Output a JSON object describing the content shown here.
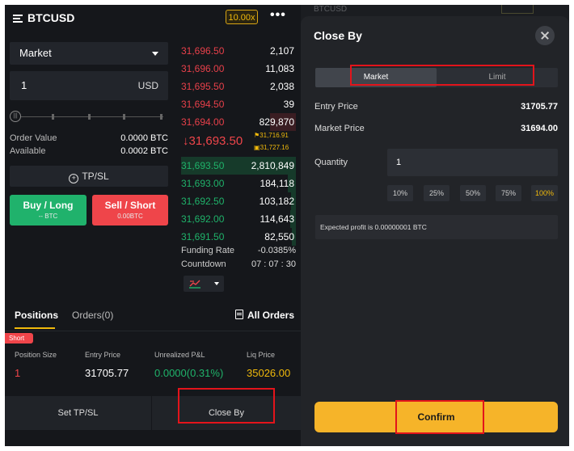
{
  "left": {
    "header": {
      "symbol": "BTCUSD",
      "leverage": "10.00x",
      "more_label": "•••"
    },
    "order_type": "Market",
    "quantity": {
      "value": "1",
      "unit": "USD"
    },
    "order_value": {
      "label": "Order Value",
      "value": "0.0000 BTC"
    },
    "available": {
      "label": "Available",
      "value": "0.0002 BTC"
    },
    "tpsl_label": "TP/SL",
    "buy": {
      "label": "Buy / Long",
      "sub": "-- BTC"
    },
    "sell": {
      "label": "Sell / Short",
      "sub": "0.00BTC"
    },
    "asks": [
      {
        "price": "31,696.50",
        "qty": "2,107"
      },
      {
        "price": "31,696.00",
        "qty": "11,083"
      },
      {
        "price": "31,695.50",
        "qty": "2,038"
      },
      {
        "price": "31,694.50",
        "qty": "39"
      },
      {
        "price": "31,694.00",
        "qty": "829,870"
      }
    ],
    "last_price": "↓31,693.50",
    "mark_price": "31,716.91",
    "index_price": "31,727.16",
    "bids": [
      {
        "price": "31,693.50",
        "qty": "2,810,849"
      },
      {
        "price": "31,693.00",
        "qty": "184,118"
      },
      {
        "price": "31,692.50",
        "qty": "103,182"
      },
      {
        "price": "31,692.00",
        "qty": "114,643"
      },
      {
        "price": "31,691.50",
        "qty": "82,550"
      }
    ],
    "funding_rate": {
      "label": "Funding Rate",
      "value": "-0.0385%"
    },
    "countdown": {
      "label": "Countdown",
      "value": "07 : 07 : 30"
    },
    "tabs": {
      "positions": "Positions",
      "orders": "Orders(0)",
      "all_orders": "All Orders"
    },
    "position": {
      "side_tag": "Short",
      "headers": [
        "Position Size",
        "Entry Price",
        "Unrealized P&L",
        "Liq Price"
      ],
      "size": "1",
      "entry_price": "31705.77",
      "pnl": "0.0000(0.31%)",
      "liq_price": "35026.00"
    },
    "bottom": {
      "set_tpsl": "Set TP/SL",
      "close_by": "Close By"
    }
  },
  "right": {
    "ghost_title": "BTCUSD",
    "title": "Close By",
    "segments": {
      "market": "Market",
      "limit": "Limit"
    },
    "entry_price": {
      "label": "Entry Price",
      "value": "31705.77"
    },
    "market_price": {
      "label": "Market Price",
      "value": "31694.00"
    },
    "quantity": {
      "label": "Quantity",
      "value": "1"
    },
    "percentages": [
      "10%",
      "25%",
      "50%",
      "75%",
      "100%"
    ],
    "selected_percentage": "100%",
    "expected_profit": "Expected profit is 0.00000001 BTC",
    "confirm": "Confirm"
  },
  "colors": {
    "accent": "#f0b90b",
    "buy": "#20b26c",
    "sell": "#ef454a",
    "highlight": "#e3141b"
  },
  "icons": [
    "menu-icon",
    "more-icon",
    "caret-down-icon",
    "plus-circle-icon",
    "flag-icon",
    "chart-icon",
    "document-icon",
    "close-icon"
  ]
}
